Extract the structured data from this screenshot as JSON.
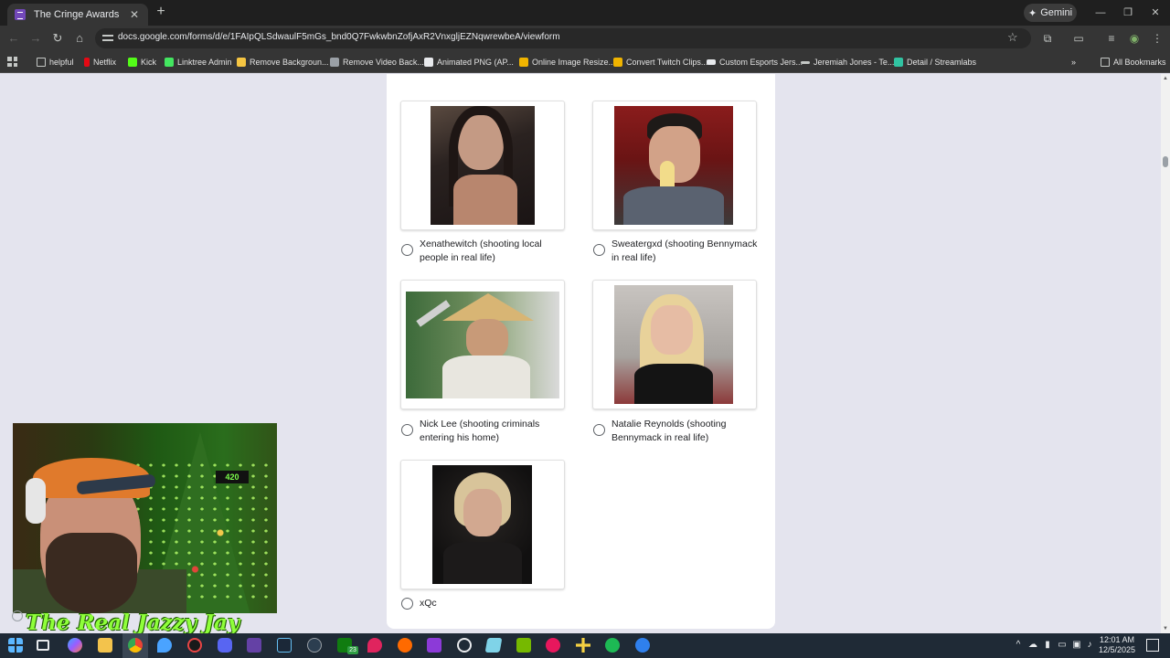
{
  "browser": {
    "tab_title": "The Cringe Awards",
    "tab_close": "✕",
    "new_tab": "+",
    "gemini_label": "Gemini",
    "url": "docs.google.com/forms/d/e/1FAIpQLSdwaulF5mGs_bnd0Q7FwkwbnZofjAxR2VnxgljEZNqwrewbeA/viewform",
    "window_controls": [
      "—",
      "❐",
      "✕"
    ]
  },
  "bookmarks": {
    "items": [
      {
        "label": "helpful",
        "color": "#c4c7c5"
      },
      {
        "label": "Netflix",
        "color": "#e50914"
      },
      {
        "label": "Kick",
        "color": "#53fc18"
      },
      {
        "label": "Linktree Admin",
        "color": "#43e660"
      },
      {
        "label": "Remove Backgroun...",
        "color": "#f5c542"
      },
      {
        "label": "Remove Video Back...",
        "color": "#9aa0a6"
      },
      {
        "label": "Animated PNG (AP...",
        "color": "#e8eaed"
      },
      {
        "label": "Online Image Resize...",
        "color": "#f0b400"
      },
      {
        "label": "Convert Twitch Clips...",
        "color": "#f0b400"
      },
      {
        "label": "Custom Esports Jers...",
        "color": "#e8eaed"
      },
      {
        "label": "Jeremiah Jones - Te...",
        "color": "#c4c7c5"
      },
      {
        "label": "Detail / Streamlabs",
        "color": "#31c3a2"
      }
    ],
    "overflow": "»",
    "all_bookmarks": "All Bookmarks"
  },
  "form": {
    "options": [
      {
        "label": "Xenathewitch (shooting local people in real life)"
      },
      {
        "label": "Sweatergxd (shooting Bennymack in real life)"
      },
      {
        "label": "Nick Lee (shooting criminals entering his home)"
      },
      {
        "label": "Natalie Reynolds (shooting Bennymack in real life)"
      },
      {
        "label": "xQc"
      }
    ]
  },
  "webcam": {
    "caption": "The Real Jazzy Jay",
    "sign": "420"
  },
  "taskbar": {
    "time": "12:01 AM",
    "date": "12/5/2025",
    "badge": "23"
  },
  "colors": {
    "page_bg": "#e4e4ee",
    "chrome_dark": "#353535",
    "form_accent": "#7248b9"
  }
}
